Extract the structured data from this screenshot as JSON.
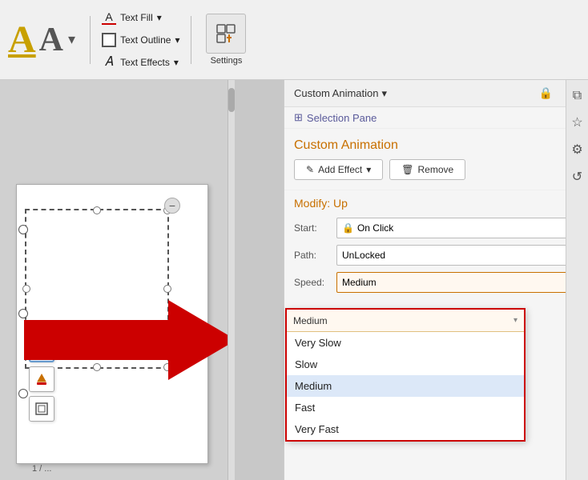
{
  "toolbar": {
    "text_fill_label": "Text Fill",
    "text_outline_label": "Text Outline",
    "text_effects_label": "Text Effects",
    "settings_label": "Settings"
  },
  "panel": {
    "title": "Custom Animation",
    "title_arrow": "▾",
    "selection_pane": "Selection Pane",
    "custom_animation_heading": "Custom Animation",
    "add_effect_label": "Add Effect",
    "remove_label": "Remove",
    "modify_label": "Modify: Up",
    "start_label": "Start:",
    "start_value": "On Click",
    "path_label": "Path:",
    "path_value": "UnLocked",
    "speed_label": "Speed:",
    "speed_value": "Medium"
  },
  "dropdown": {
    "header": "Medium",
    "items": [
      {
        "label": "Very Slow",
        "selected": false
      },
      {
        "label": "Slow",
        "selected": false
      },
      {
        "label": "Medium",
        "selected": true
      },
      {
        "label": "Fast",
        "selected": false
      },
      {
        "label": "Very Fast",
        "selected": false
      }
    ]
  },
  "slide": {
    "page_indicator": "1 / ..."
  },
  "icons": {
    "lock": "🔒",
    "close": "✕",
    "copy": "⧉",
    "star": "☆",
    "sliders": "⚙",
    "history": "↺",
    "pencil": "✏",
    "drop_arrow": "▾",
    "chevron_down": "▾",
    "add_icon": "✎",
    "trash_icon": "🗑",
    "selection_icon": "⊞",
    "paint_icon": "🎨",
    "shape_icon": "⬡",
    "frame_icon": "▣"
  }
}
